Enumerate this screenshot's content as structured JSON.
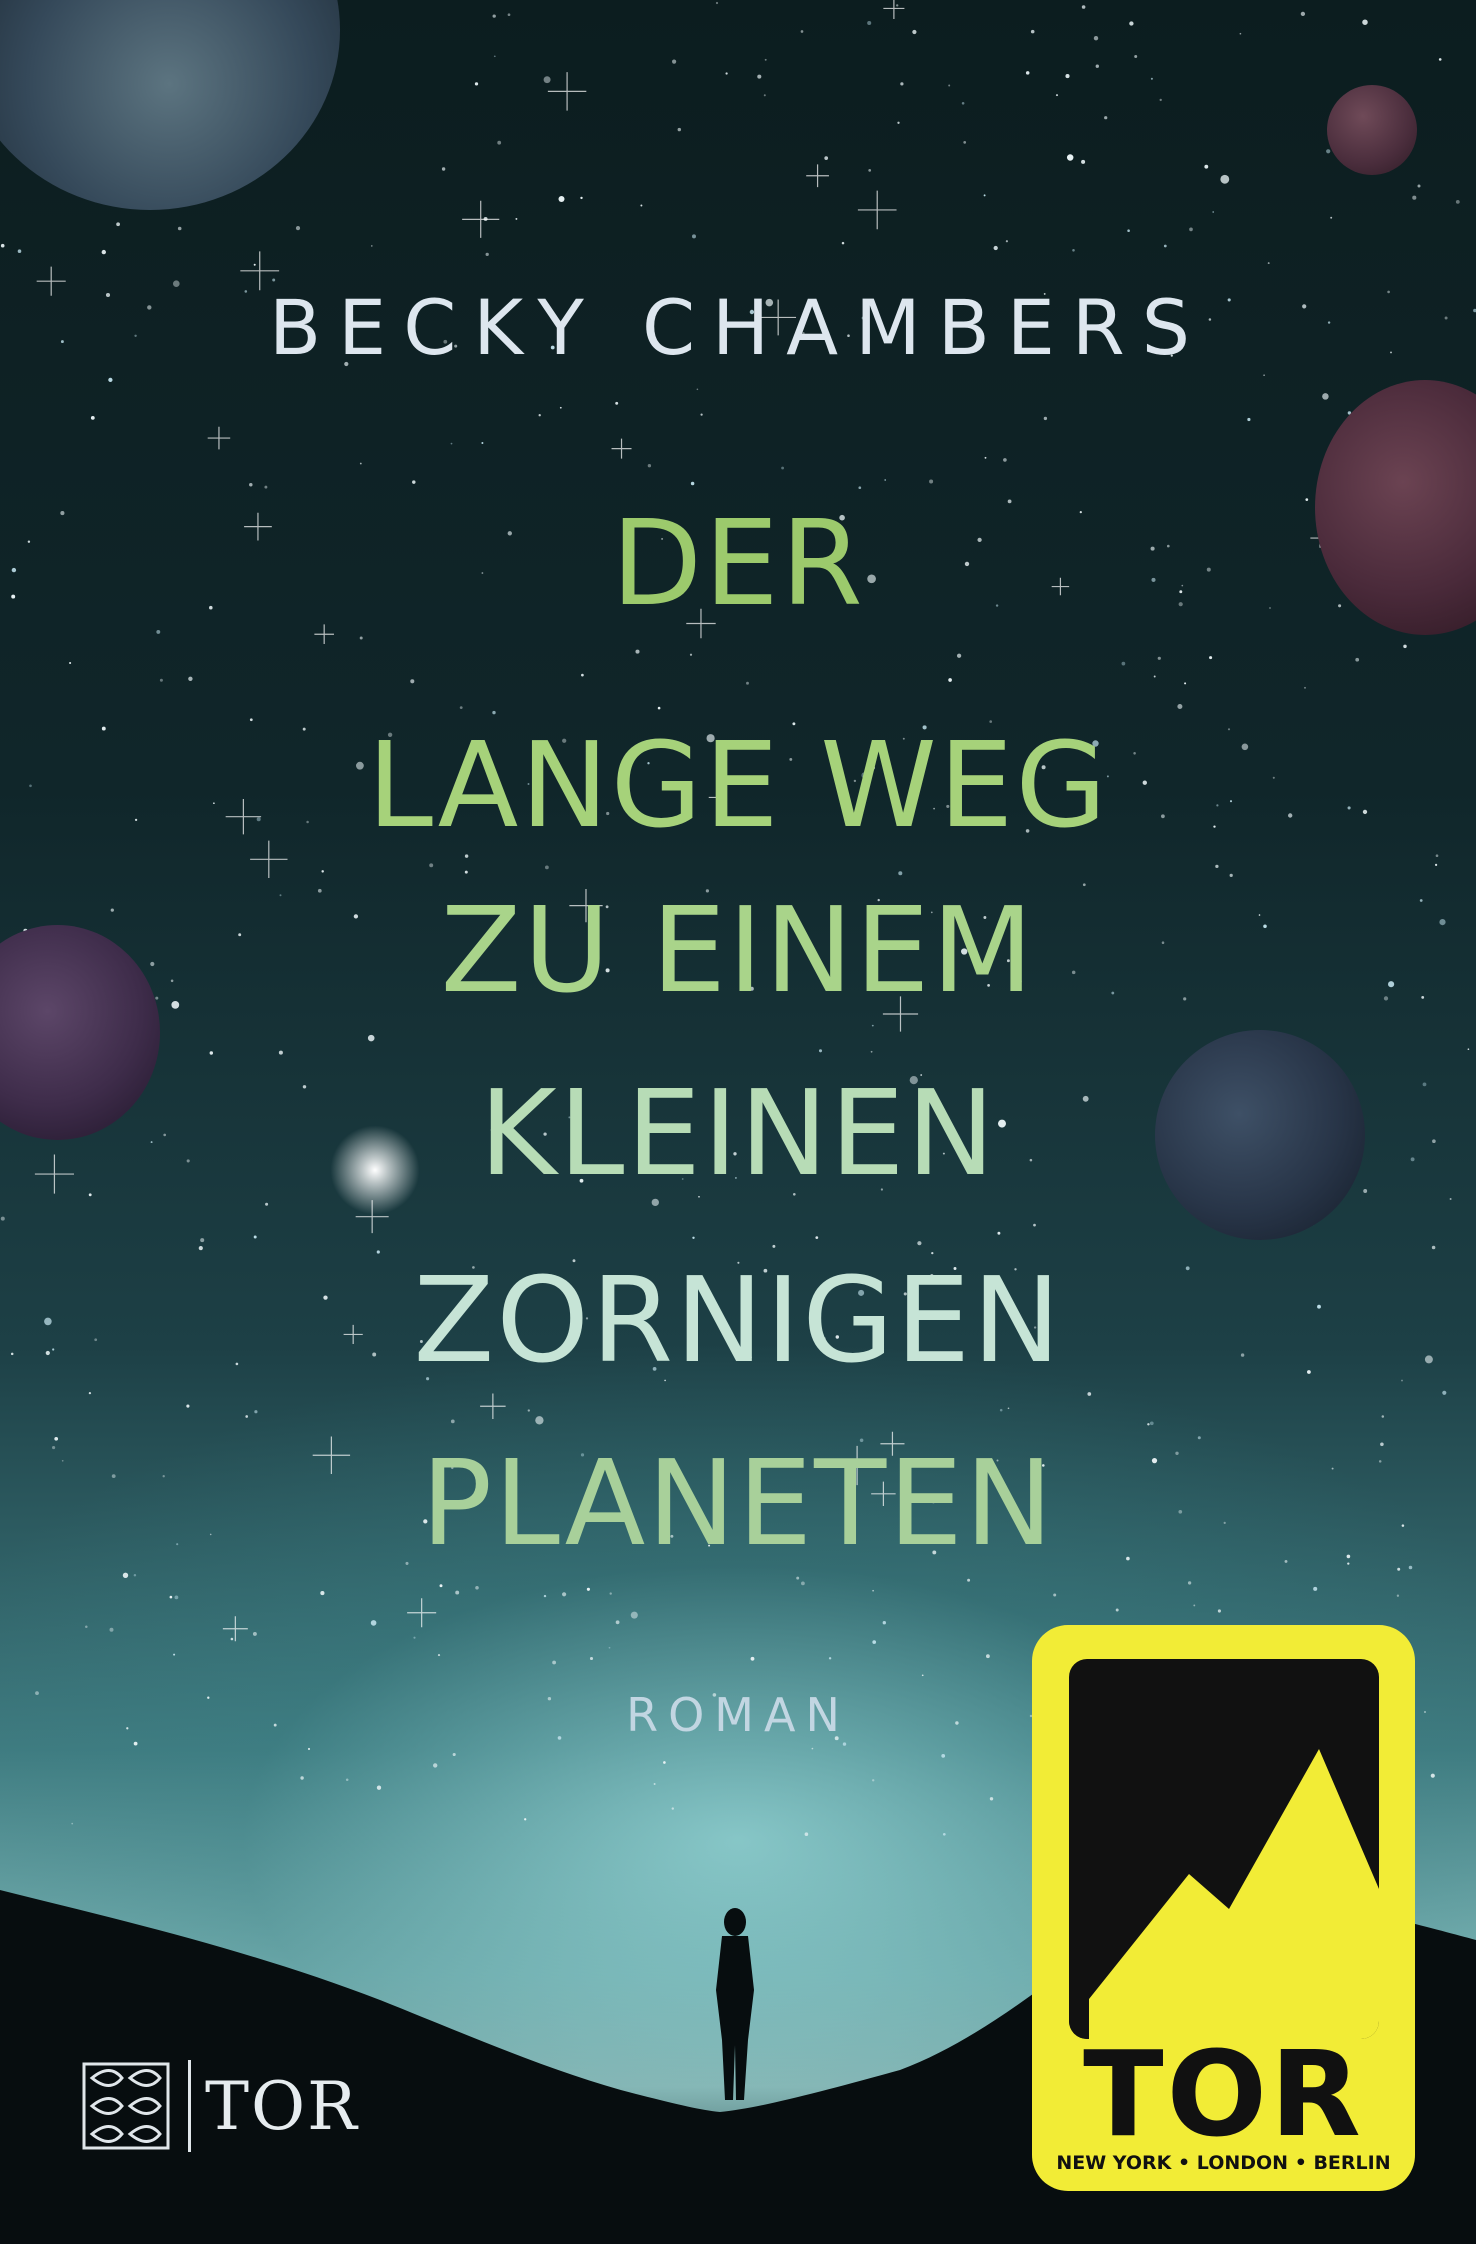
{
  "cover": {
    "author": "BECKY CHAMBERS",
    "title_lines": [
      "DER",
      "LANGE WEG",
      "ZU EINEM",
      "KLEINEN",
      "ZORNIGEN",
      "PLANETEN"
    ],
    "subtitle": "ROMAN",
    "publisher_name": "TOR"
  },
  "badge": {
    "name": "TOR",
    "cities": "NEW YORK • LONDON • BERLIN",
    "color": "#f2ec36"
  },
  "colors": {
    "title": "#a6d27a",
    "author": "#dde6ee",
    "sky_dark": "#0c1d1f",
    "horizon_glow": "#a9cfcb"
  }
}
